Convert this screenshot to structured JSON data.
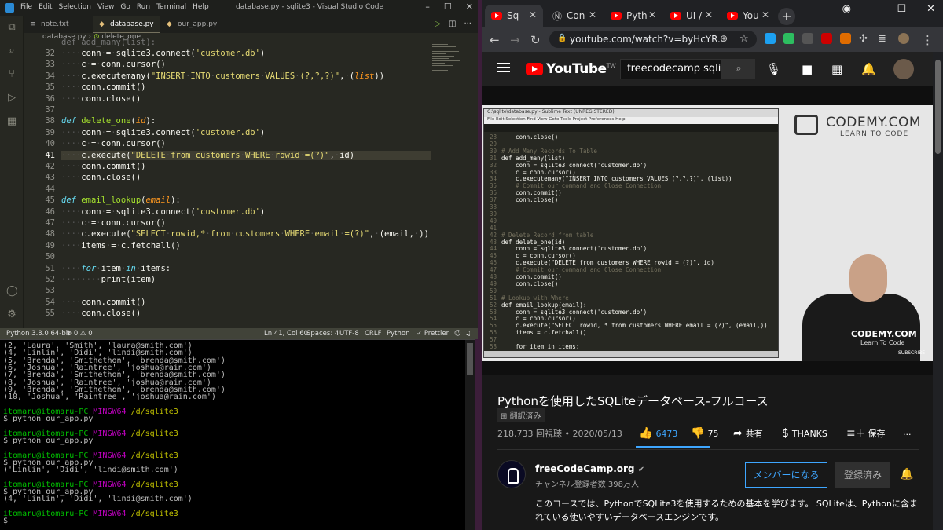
{
  "vscode": {
    "menu": [
      "File",
      "Edit",
      "Selection",
      "View",
      "Go",
      "Run",
      "Terminal",
      "Help"
    ],
    "window_title": "database.py - sqlite3 - Visual Studio Code",
    "tabs": [
      {
        "label": "note.txt"
      },
      {
        "label": "database.py"
      },
      {
        "label": "our_app.py"
      }
    ],
    "breadcrumb": {
      "file": "database.py",
      "symbol": "delete_one"
    },
    "lines": [
      {
        "n": "32",
        "html": "<span class='ws'>····</span>conn<span class='ws'>·</span>=<span class='ws'>·</span>sqlite3.connect(<span class='str'>'customer.db'</span>)"
      },
      {
        "n": "33",
        "html": "<span class='ws'>····</span>c<span class='ws'>·</span>=<span class='ws'>·</span>conn.cursor()"
      },
      {
        "n": "34",
        "html": "<span class='ws'>····</span>c.executemany(<span class='str'>\"INSERT<span class='ws'>·</span>INTO<span class='ws'>·</span>customers<span class='ws'>·</span>VALUES<span class='ws'>·</span>(?,?,?)\"</span>,<span class='ws'>·</span>(<span class='par'>list</span>))"
      },
      {
        "n": "35",
        "html": "<span class='ws'>····</span>conn.commit()"
      },
      {
        "n": "36",
        "html": "<span class='ws'>····</span>conn.close()"
      },
      {
        "n": "37",
        "html": ""
      },
      {
        "n": "38",
        "html": "<span class='kw'>def</span> <span class='fn'>delete_one</span>(<span class='par'>id</span>):"
      },
      {
        "n": "39",
        "html": "<span class='ws'>····</span>conn<span class='ws'>·</span>=<span class='ws'>·</span>sqlite3.connect(<span class='str'>'customer.db'</span>)"
      },
      {
        "n": "40",
        "html": "<span class='ws'>····</span>c<span class='ws'>·</span>=<span class='ws'>·</span>conn.cursor()"
      },
      {
        "n": "41",
        "html": "<span class='ws'>····</span>c.execute(<span class='str'>\"DELETE<span class='ws'>·</span>from<span class='ws'>·</span>customers<span class='ws'>·</span>WHERE<span class='ws'>·</span>rowid<span class='ws'>·</span>=(?)\"</span>,<span class='ws'>·</span>id)"
      },
      {
        "n": "42",
        "html": "<span class='ws'>····</span>conn.commit()"
      },
      {
        "n": "43",
        "html": "<span class='ws'>····</span>conn.close()"
      },
      {
        "n": "44",
        "html": ""
      },
      {
        "n": "45",
        "html": "<span class='kw'>def</span> <span class='fn'>email_lookup</span>(<span class='par'>email</span>):"
      },
      {
        "n": "46",
        "html": "<span class='ws'>····</span>conn<span class='ws'>·</span>=<span class='ws'>·</span>sqlite3.connect(<span class='str'>'customer.db'</span>)"
      },
      {
        "n": "47",
        "html": "<span class='ws'>····</span>c<span class='ws'>·</span>=<span class='ws'>·</span>conn.cursor()"
      },
      {
        "n": "48",
        "html": "<span class='ws'>····</span>c.execute(<span class='str'>\"SELECT<span class='ws'>·</span>rowid,*<span class='ws'>·</span>from<span class='ws'>·</span>customers<span class='ws'>·</span>WHERE<span class='ws'>·</span>email<span class='ws'>·</span>=(?)\"</span>,<span class='ws'>·</span>(email,<span class='ws'>·</span>))"
      },
      {
        "n": "49",
        "html": "<span class='ws'>····</span>items<span class='ws'>·</span>=<span class='ws'>·</span>c.fetchall()"
      },
      {
        "n": "50",
        "html": ""
      },
      {
        "n": "51",
        "html": "<span class='ws'>····</span><span class='kw'>for</span><span class='ws'>·</span>item<span class='ws'>·</span><span class='kw'>in</span><span class='ws'>·</span>items:"
      },
      {
        "n": "52",
        "html": "<span class='ws'>········</span>print(item)"
      },
      {
        "n": "53",
        "html": ""
      },
      {
        "n": "54",
        "html": "<span class='ws'>····</span>conn.commit()"
      },
      {
        "n": "55",
        "html": "<span class='ws'>····</span>conn.close()"
      }
    ],
    "top_partial_line": "def add_many(list):",
    "status": {
      "python": "Python 3.8.0 64-bit",
      "problems": "⊗ 0 ⚠ 0",
      "position": "Ln 41, Col 60",
      "spaces": "Spaces: 4",
      "encoding": "UTF-8",
      "eol": "CRLF",
      "language": "Python",
      "prettier": "✓ Prettier"
    }
  },
  "terminal": {
    "lines": [
      {
        "t": "(2, 'Laura', 'Smith', 'laura@smith.com')"
      },
      {
        "t": "(4, 'Linlin', 'Didi', 'lindi@smith.com')"
      },
      {
        "t": "(5, 'Brenda', 'Smithethon', 'brenda@smith.com')"
      },
      {
        "t": "(6, 'Joshua', 'Raintree', 'joshua@rain.com')"
      },
      {
        "t": "(7, 'Brenda', 'Smithethon', 'brenda@smith.com')"
      },
      {
        "t": "(8, 'Joshua', 'Raintree', 'joshua@rain.com')"
      },
      {
        "t": "(9, 'Brenda', 'Smithethon', 'brenda@smith.com')"
      },
      {
        "t": "(10, 'Joshua', 'Raintree', 'joshua@rain.com')"
      },
      {
        "t": ""
      },
      {
        "prompt": true,
        "user": "itomaru@itomaru-PC",
        "sys": "MINGW64",
        "path": "/d/sqlite3"
      },
      {
        "t": "$ python our_app.py"
      },
      {
        "t": ""
      },
      {
        "prompt": true,
        "user": "itomaru@itomaru-PC",
        "sys": "MINGW64",
        "path": "/d/sqlite3"
      },
      {
        "t": "$ python our_app.py"
      },
      {
        "t": ""
      },
      {
        "prompt": true,
        "user": "itomaru@itomaru-PC",
        "sys": "MINGW64",
        "path": "/d/sqlite3"
      },
      {
        "t": "$ python our_app.py"
      },
      {
        "t": "('Linlin', 'Didi', 'lindi@smith.com')"
      },
      {
        "t": ""
      },
      {
        "prompt": true,
        "user": "itomaru@itomaru-PC",
        "sys": "MINGW64",
        "path": "/d/sqlite3"
      },
      {
        "t": "$ python our_app.py"
      },
      {
        "t": "(4, 'Linlin', 'Didi', 'lindi@smith.com')"
      },
      {
        "t": ""
      },
      {
        "prompt": true,
        "user": "itomaru@itomaru-PC",
        "sys": "MINGW64",
        "path": "/d/sqlite3"
      },
      {
        "t": "$ "
      }
    ]
  },
  "chrome": {
    "tabs": [
      {
        "label": "Sq",
        "active": true
      },
      {
        "label": "Con"
      },
      {
        "label": "Pyth"
      },
      {
        "label": "UI /"
      },
      {
        "label": "You"
      }
    ],
    "url": "youtube.com/watch?v=byHcYR..."
  },
  "youtube": {
    "logo": "YouTube",
    "logo_sup": "TW",
    "search_value": "freecodecamp sqlite",
    "video": {
      "sub_title": "C:\\sqlite\\database.py - Sublime Text (UNREGISTERED)",
      "sub_menu": "File   Edit   Selection   Find   View   Goto   Tools   Project   Preferences   Help",
      "sub_lines": [
        {
          "n": "28",
          "t": "    conn.close()"
        },
        {
          "n": "29",
          "t": ""
        },
        {
          "n": "30",
          "t": "# Add Many Records To Table",
          "c": true
        },
        {
          "n": "31",
          "t": "def add_many(list):"
        },
        {
          "n": "32",
          "t": "    conn = sqlite3.connect('customer.db')"
        },
        {
          "n": "33",
          "t": "    c = conn.cursor()"
        },
        {
          "n": "34",
          "t": "    c.executemany(\"INSERT INTO customers VALUES (?,?,?)\", (list))"
        },
        {
          "n": "35",
          "t": "    # Commit our command and Close Connection",
          "c": true
        },
        {
          "n": "36",
          "t": "    conn.commit()"
        },
        {
          "n": "37",
          "t": "    conn.close()"
        },
        {
          "n": "38",
          "t": ""
        },
        {
          "n": "39",
          "t": ""
        },
        {
          "n": "40",
          "t": ""
        },
        {
          "n": "41",
          "t": ""
        },
        {
          "n": "42",
          "t": "# Delete Record from table",
          "c": true
        },
        {
          "n": "43",
          "t": "def delete_one(id):"
        },
        {
          "n": "44",
          "t": "    conn = sqlite3.connect('customer.db')"
        },
        {
          "n": "45",
          "t": "    c = conn.cursor()"
        },
        {
          "n": "46",
          "t": "    c.execute(\"DELETE from customers WHERE rowid = (?)\", id)"
        },
        {
          "n": "47",
          "t": "    # Commit our command and Close Connection",
          "c": true
        },
        {
          "n": "48",
          "t": "    conn.commit()"
        },
        {
          "n": "49",
          "t": "    conn.close()"
        },
        {
          "n": "50",
          "t": ""
        },
        {
          "n": "51",
          "t": "# Lookup with Where",
          "c": true
        },
        {
          "n": "52",
          "t": "def email_lookup(email):"
        },
        {
          "n": "53",
          "t": "    conn = sqlite3.connect('customer.db')"
        },
        {
          "n": "54",
          "t": "    c = conn.cursor()"
        },
        {
          "n": "55",
          "t": "    c.execute(\"SELECT rowid, * from customers WHERE email = (?)\", (email,))"
        },
        {
          "n": "56",
          "t": "    items = c.fetchall()"
        },
        {
          "n": "57",
          "t": ""
        },
        {
          "n": "58",
          "t": "    for item in items:"
        }
      ],
      "codemy_name": "CODEMY.COM",
      "codemy_tag": "LEARN TO CODE",
      "shirt_text": "CODEMY.COM",
      "shirt_sub": "Learn To Code",
      "subscribe": "SUBSCRIBE"
    },
    "title": "Pythonを使用したSQLiteデータベース-フルコース",
    "translated_badge": "翻訳済み",
    "views_date": "218,733 回視聴 • 2020/05/13",
    "likes": "6473",
    "dislikes": "75",
    "share": "共有",
    "thanks": "THANKS",
    "save": "保存",
    "more": "...",
    "channel_name": "freeCodeCamp.org",
    "channel_subs": "チャンネル登録者数 398万人",
    "member_button": "メンバーになる",
    "subscribed_button": "登録済み",
    "description": "このコースでは、PythonでSQLite3を使用するための基本を学びます。 SQLiteは、Pythonに含まれている使いやすいデータベースエンジンです。"
  }
}
